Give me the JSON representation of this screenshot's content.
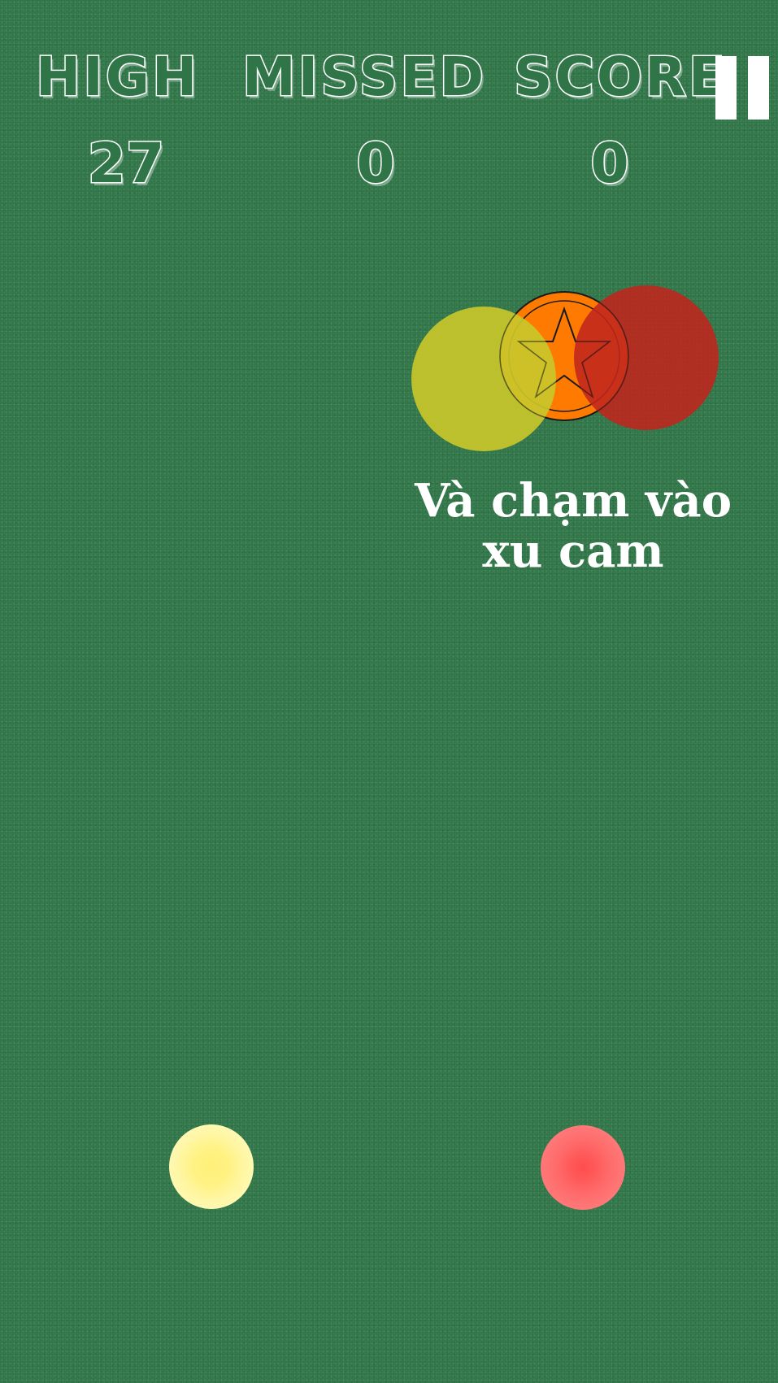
{
  "hud": {
    "high_label": "HIGH",
    "missed_label": "MISSED",
    "score_label": "SCORE",
    "high_value": "27",
    "missed_value": "0",
    "score_value": "0"
  },
  "pause": {
    "icon": "pause-icon"
  },
  "tutorial": {
    "hint_line_1": "Và chạm vào",
    "hint_line_2": "xu cam",
    "coin_icon": "star-coin-icon"
  },
  "colors": {
    "background": "#2f7547",
    "yellow_ball": "#c9c72a",
    "red_ball": "#c0261c",
    "orange_coin": "#ff7a00",
    "yellow_button": "#fff283",
    "red_button": "#ff5a5a"
  },
  "controls": {
    "left_button": "yellow-tap-button",
    "right_button": "red-tap-button"
  }
}
